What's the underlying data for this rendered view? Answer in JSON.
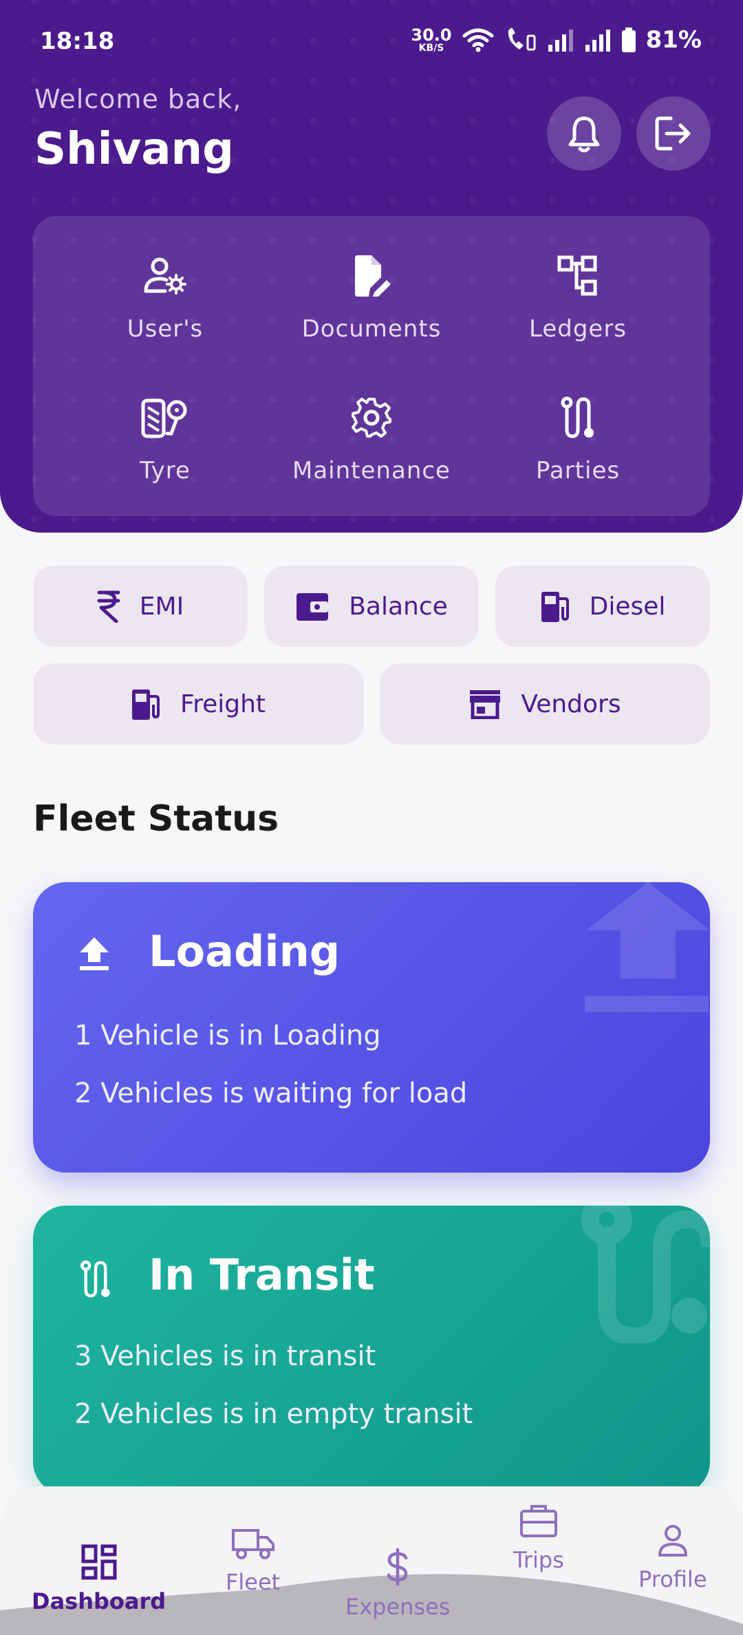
{
  "status_bar": {
    "time": "18:18",
    "net_speed_value": "30.0",
    "net_speed_unit": "KB/S",
    "battery": "81%"
  },
  "header": {
    "welcome": "Welcome back,",
    "user_name": "Shivang",
    "bell_icon": "bell-icon",
    "logout_icon": "logout-icon"
  },
  "quick_actions": [
    {
      "label": "User's",
      "icon": "user-settings-icon"
    },
    {
      "label": "Documents",
      "icon": "document-edit-icon"
    },
    {
      "label": "Ledgers",
      "icon": "hierarchy-icon"
    },
    {
      "label": "Tyre",
      "icon": "tyre-icon"
    },
    {
      "label": "Maintenance",
      "icon": "gear-icon"
    },
    {
      "label": "Parties",
      "icon": "route-icon"
    }
  ],
  "chips": [
    {
      "label": "EMI",
      "icon": "rupee-icon"
    },
    {
      "label": "Balance",
      "icon": "wallet-icon"
    },
    {
      "label": "Diesel",
      "icon": "fuel-icon"
    },
    {
      "label": "Freight",
      "icon": "fuel-icon"
    },
    {
      "label": "Vendors",
      "icon": "store-icon"
    }
  ],
  "fleet_status": {
    "title": "Fleet Status",
    "loading": {
      "title": "Loading",
      "line1": "1 Vehicle is in Loading",
      "line2": "2 Vehicles is waiting for load"
    },
    "transit": {
      "title": "In Transit",
      "line1": "3 Vehicles is in transit",
      "line2": "2 Vehicles is in empty transit"
    }
  },
  "bottom_nav": [
    {
      "label": "Dashboard",
      "icon": "dashboard-icon",
      "active": true
    },
    {
      "label": "Fleet",
      "icon": "truck-icon",
      "active": false
    },
    {
      "label": "Expenses",
      "icon": "dollar-icon",
      "active": false
    },
    {
      "label": "Trips",
      "icon": "briefcase-icon",
      "active": false
    },
    {
      "label": "Profile",
      "icon": "person-icon",
      "active": false
    }
  ],
  "colors": {
    "primary": "#4b1a8c",
    "loading_card": "#5b57e8",
    "transit_card": "#17a593",
    "chip_bg": "#ece6f0"
  }
}
